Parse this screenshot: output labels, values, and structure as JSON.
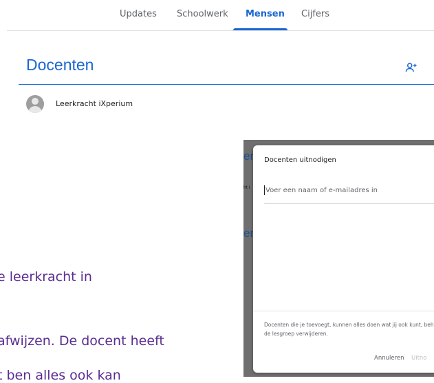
{
  "tabs": [
    {
      "label": "Updates",
      "active": false
    },
    {
      "label": "Schoolwerk",
      "active": false
    },
    {
      "label": "Mensen",
      "active": true
    },
    {
      "label": "Cijfers",
      "active": false
    }
  ],
  "section": {
    "title": "Docenten",
    "add_icon": "person-add-icon"
  },
  "teacher": {
    "name": "Leerkracht iXperium"
  },
  "doc_text": {
    "line1": "e leerkracht in",
    "line2": "afwijzen. De docent heeft",
    "line3": "t ben alles ook kan"
  },
  "screenshot": {
    "bg_fragment_1": "en",
    "bg_fragment_2": "ht i",
    "bg_fragment_3": "er",
    "dialog": {
      "title": "Docenten uitnodigen",
      "placeholder": "Voer een naam of e-mailadres in",
      "notice_line1": "Docenten die je toevoegt, kunnen alles doen wat jij ook kunt, beh",
      "notice_line2": "de lesgroep verwijderen.",
      "cancel_label": "Annuleren",
      "invite_label": "Uitno"
    }
  },
  "colors": {
    "accent": "#1967d2",
    "doc_text": "#5a2d91"
  }
}
